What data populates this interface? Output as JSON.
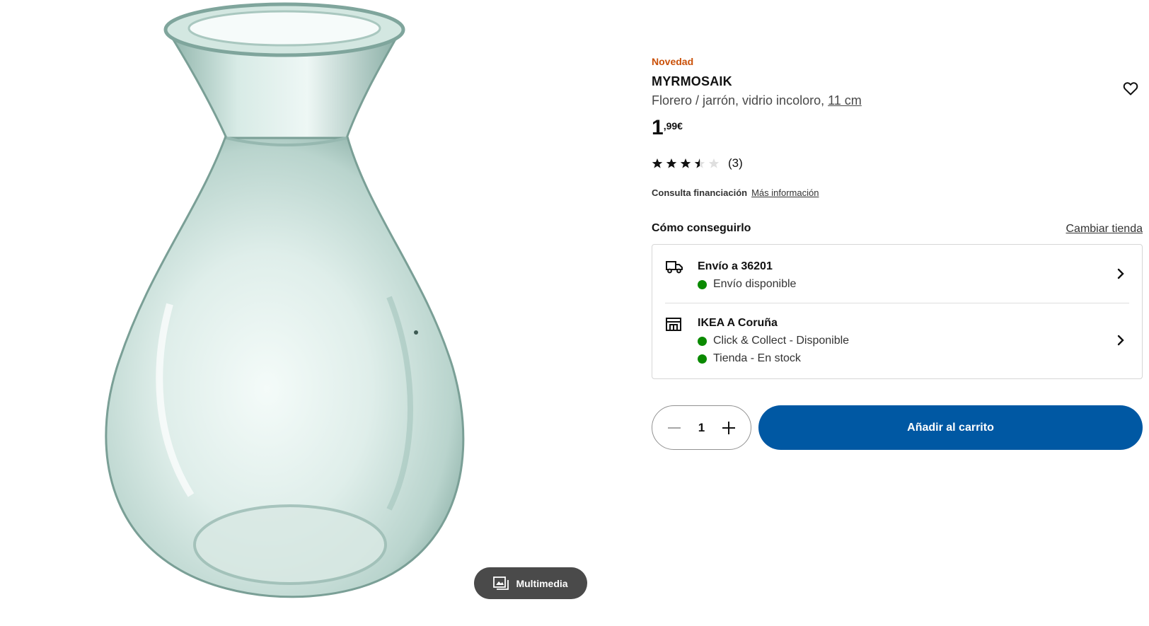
{
  "media": {
    "image_alt": "MYRMOSAIK florero de vidrio incoloro",
    "multimedia_label": "Multimedia"
  },
  "product": {
    "badge": "Novedad",
    "name": "MYRMOSAIK",
    "description": "Florero / jarrón, vidrio incoloro, ",
    "measure": "11 cm",
    "price_integer": "1",
    "price_decimal": ",99€",
    "rating_value": 3.5,
    "rating_max": 5,
    "rating_count": "(3)"
  },
  "finance": {
    "label": "Consulta financiación",
    "link": "Más información"
  },
  "availability": {
    "title": "Cómo conseguirlo",
    "change_store": "Cambiar tienda",
    "delivery": {
      "title": "Envío a 36201",
      "status": "Envío disponible",
      "icon": "truck-icon"
    },
    "store": {
      "title": "IKEA A Coruña",
      "status_collect": "Click & Collect - Disponible",
      "status_store": "Tienda - En stock",
      "icon": "store-icon"
    },
    "status_color": "#0a8a00"
  },
  "cart": {
    "quantity": "1",
    "add_label": "Añadir al carrito",
    "accent": "#0058a3"
  },
  "colors": {
    "badge_new": "#ca5008",
    "button_dark": "#4a4a4a"
  }
}
